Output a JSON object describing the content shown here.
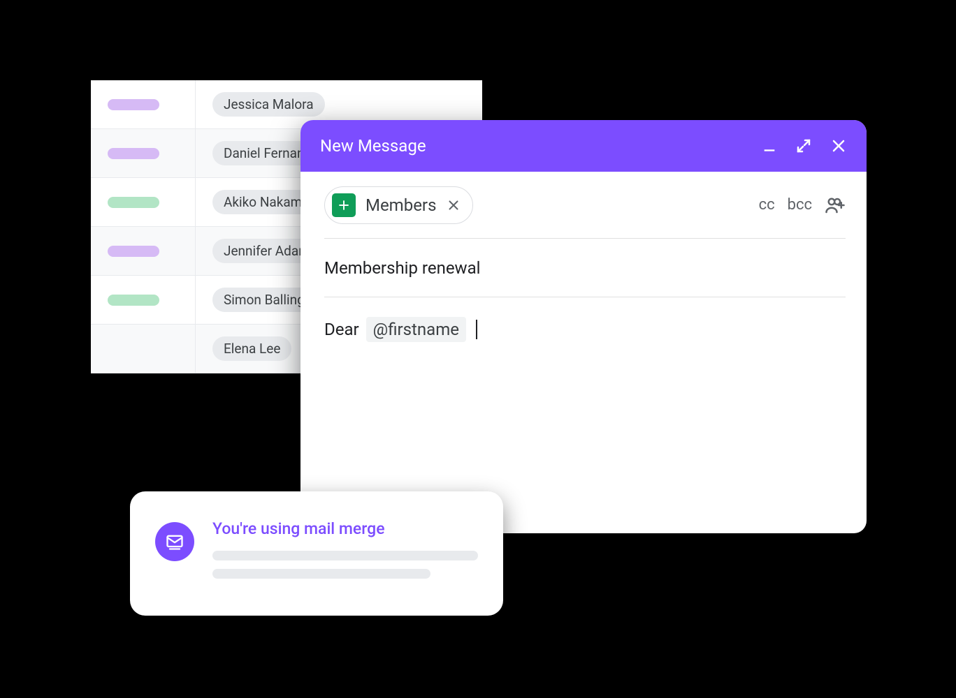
{
  "sheet": {
    "rows": [
      {
        "tagColor": "purple",
        "name": "Jessica Malora"
      },
      {
        "tagColor": "purple",
        "name": "Daniel Fernandez"
      },
      {
        "tagColor": "green",
        "name": "Akiko Nakamura"
      },
      {
        "tagColor": "purple",
        "name": "Jennifer Adams"
      },
      {
        "tagColor": "green",
        "name": "Simon Ballinger"
      },
      {
        "tagColor": "",
        "name": "Elena Lee"
      }
    ]
  },
  "compose": {
    "title": "New Message",
    "cc_label": "cc",
    "bcc_label": "bcc",
    "recipient_chip": {
      "label": "Members"
    },
    "subject": "Membership renewal",
    "body_prefix": "Dear",
    "merge_tag": "@firstname"
  },
  "toast": {
    "title": "You're using mail merge"
  }
}
